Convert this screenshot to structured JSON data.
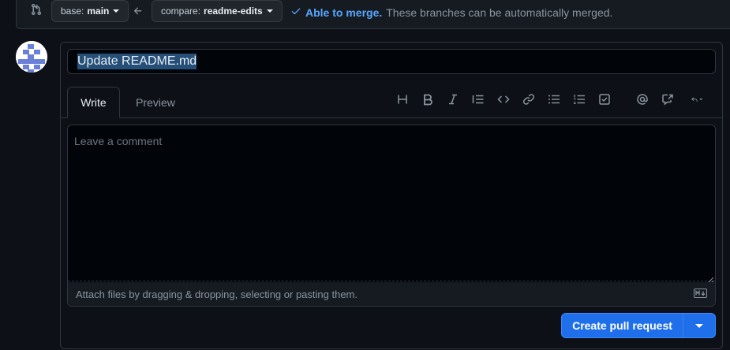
{
  "compare": {
    "base_label": "base:",
    "base_value": "main",
    "compare_label": "compare:",
    "compare_value": "readme-edits",
    "merge_status": "Able to merge.",
    "merge_desc": "These branches can be automatically merged."
  },
  "form": {
    "title_value": "Update README.md",
    "tabs": [
      {
        "label": "Write",
        "active": true
      },
      {
        "label": "Preview",
        "active": false
      }
    ],
    "toolbar_icons": [
      "heading-icon",
      "bold-icon",
      "italic-icon",
      "quote-icon",
      "code-icon",
      "link-icon",
      "bulleted-list-icon",
      "numbered-list-icon",
      "task-list-icon",
      "mention-icon",
      "cross-reference-icon",
      "saved-replies-icon"
    ],
    "comment_placeholder": "Leave a comment",
    "attach_text": "Attach files by dragging & dropping, selecting or pasting them.",
    "submit_label": "Create pull request"
  },
  "colors": {
    "accent": "#1f6feb",
    "link": "#58a6ff",
    "background": "#0d1117"
  }
}
